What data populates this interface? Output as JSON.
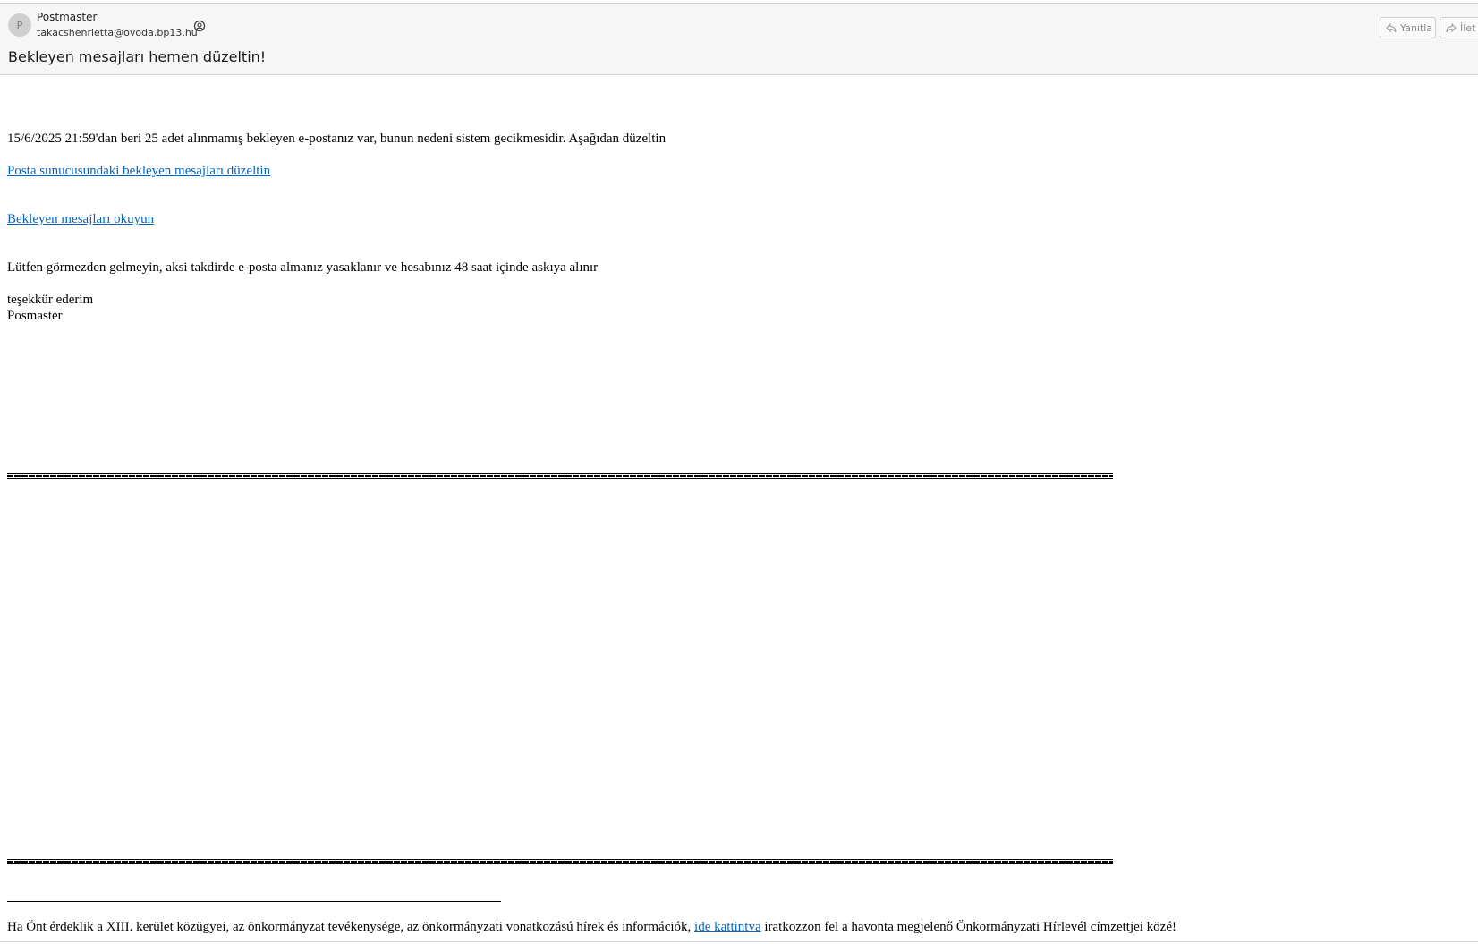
{
  "header": {
    "avatar_initial": "P",
    "sender_name": "Postmaster",
    "sender_email": "takacshenrietta@ovoda.bp13.hu",
    "subject": "Bekleyen mesajları hemen düzeltin!",
    "reply_label": "Yanıtla",
    "forward_label": "İlet"
  },
  "body": {
    "intro": "15/6/2025 21:59'dan beri 25 adet alınmamış bekleyen e-postanız var, bunun nedeni sistem gecikmesidir. Aşağıdan düzeltin",
    "link_fix": "Posta sunucusundaki bekleyen mesajları düzeltin",
    "link_read": "Bekleyen mesajları okuyun",
    "warning": "Lütfen görmezden gelmeyin, aksi takdirde e-posta almanız yasaklanır ve hesabınız 48 saat içinde askıya alınır",
    "thanks": "teşekkür ederim",
    "signature": "Posmaster"
  },
  "footer": {
    "text_before": "Ha Önt érdeklik a XIII. kerület közügyei, az önkormányzat tevékenysége, az önkormányzati vonatkozású hírek és információk, ",
    "link": "ide kattintva",
    "text_after": " iratkozzon fel a havonta megjelenő Önkormányzati Hírlevél címzettjei közé!"
  },
  "colors": {
    "link": "#0563c1",
    "header_bg": "#f6f6f6"
  },
  "icons": [
    "contact-card-icon",
    "reply-icon",
    "forward-icon"
  ]
}
